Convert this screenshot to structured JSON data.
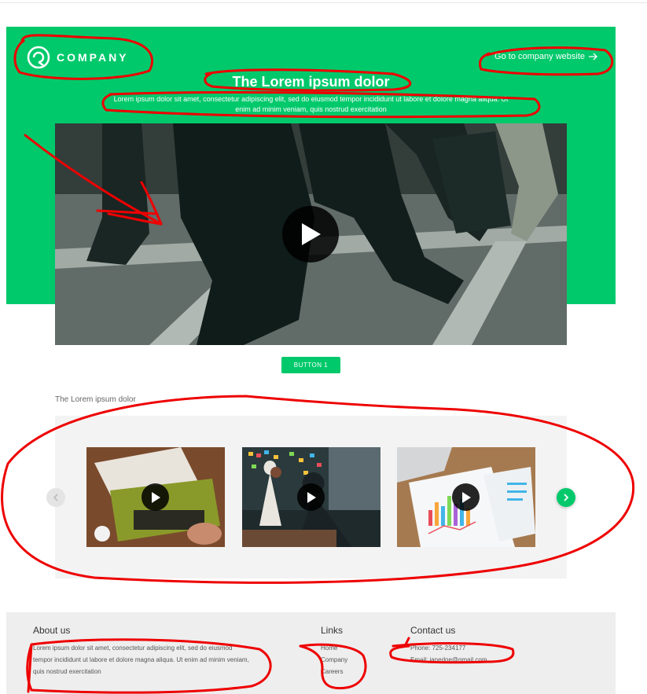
{
  "header": {
    "logo_text": "COMPANY",
    "company_link": "Go to company website",
    "title": "The Lorem ipsum dolor",
    "subtitle": "Lorem ipsum dolor sit amet, consectetur adipiscing elit, sed do eiusmod tempor incididunt ut labore et dolore magna aliqua. Ut enim ad minim veniam, quis nostrud exercitation"
  },
  "main": {
    "button_label": "BUTTON 1",
    "section_title": "The Lorem ipsum dolor",
    "cards": [
      {
        "image_subject": "marketing-typewriter"
      },
      {
        "image_subject": "office-meeting"
      },
      {
        "image_subject": "charts-laptop"
      }
    ]
  },
  "footer": {
    "about": {
      "heading": "About us",
      "text": "Lorem ipsum dolor sit amet, consectetur adipiscing elit, sed do eiusmod tempor incididunt ut labore et dolore magna aliqua. Ut enim ad minim veniam, quis nostrud exercitation"
    },
    "links": {
      "heading": "Links",
      "items": [
        "Home",
        "Company",
        "Careers"
      ]
    },
    "contact": {
      "heading": "Contact us",
      "phone": "Phone: 725-234177",
      "email": "Email: janedoe@gmail.com"
    }
  },
  "icons": [
    "logo-icon",
    "arrow-right-icon",
    "play-icon",
    "chevron-left-icon",
    "chevron-right-icon"
  ],
  "colors": {
    "brand": "#00c96b",
    "annotation": "#ee0000"
  }
}
